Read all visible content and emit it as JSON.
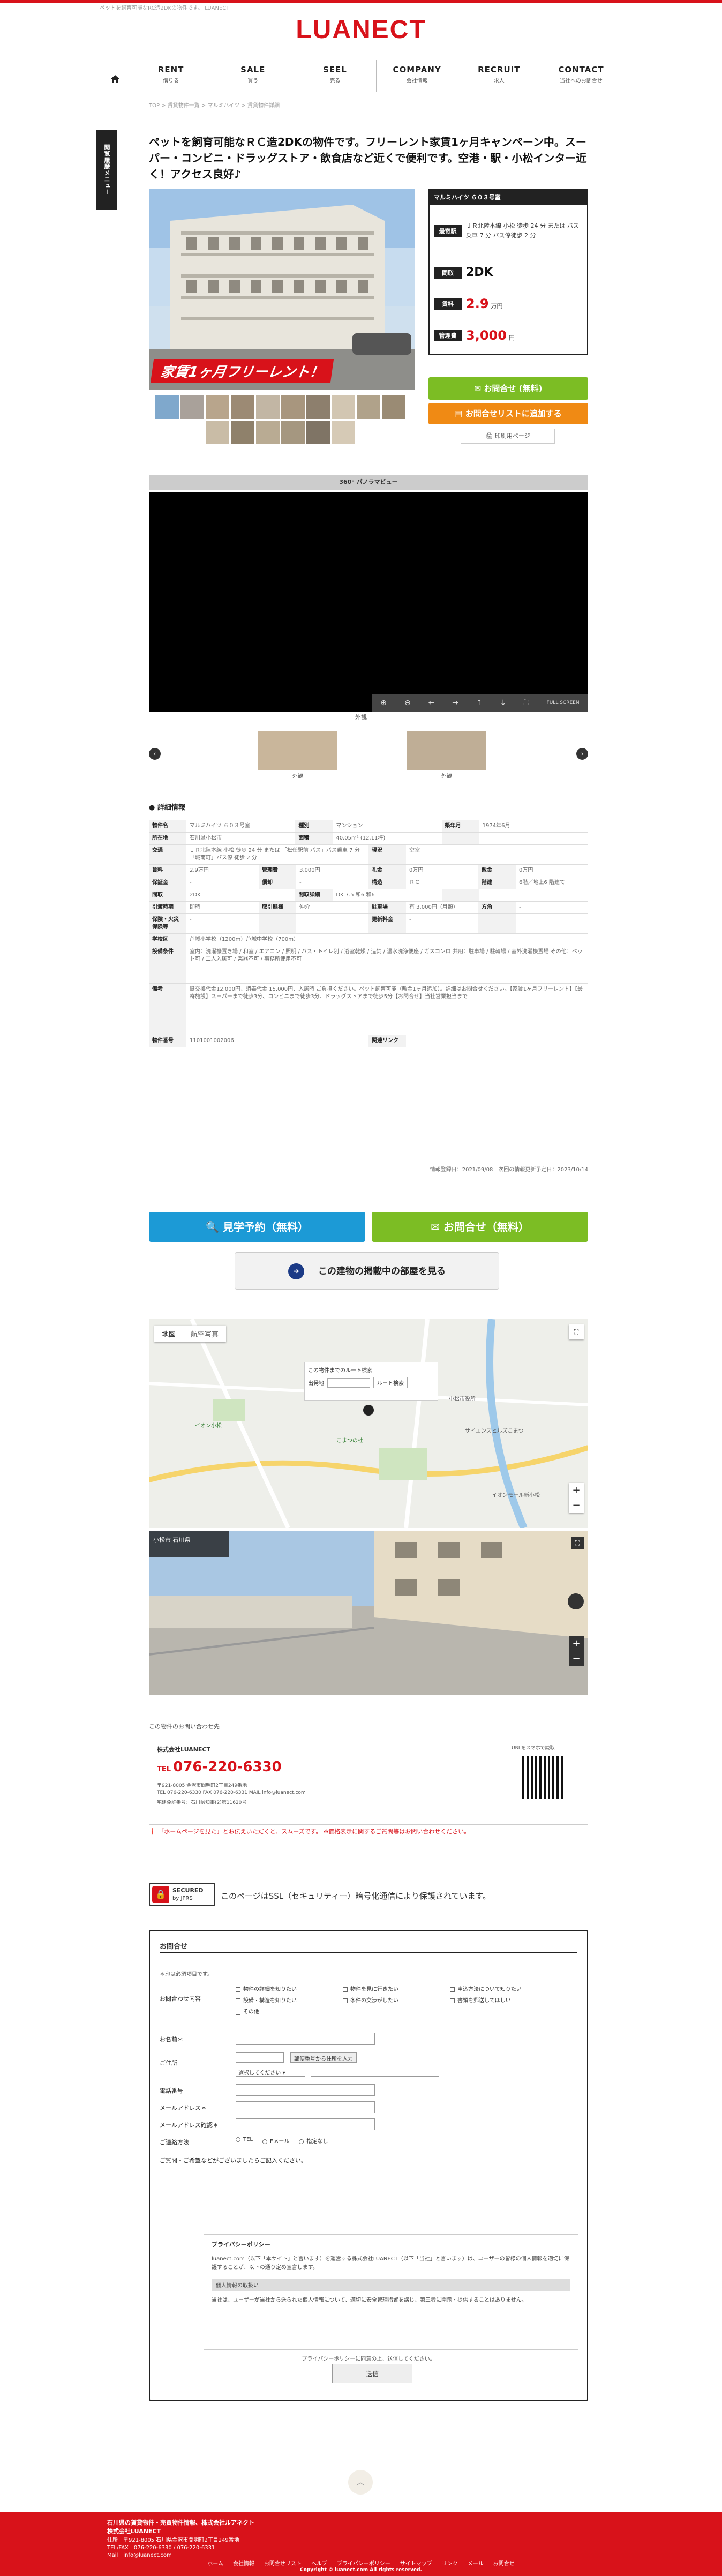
{
  "header": {
    "tagline": "ペットを飼育可能なRC造2DKの物件です。 LUANECT",
    "logo": "LUANECT"
  },
  "nav": [
    {
      "en": "RENT",
      "jp": "借りる"
    },
    {
      "en": "SALE",
      "jp": "買う"
    },
    {
      "en": "SEEL",
      "jp": "売る"
    },
    {
      "en": "COMPANY",
      "jp": "会社情報"
    },
    {
      "en": "RECRUIT",
      "jp": "求人"
    },
    {
      "en": "CONTACT",
      "jp": "当社へのお問合せ"
    }
  ],
  "breadcrumb": "TOP > 賃貸物件一覧 > マルミハイツ > 賃貸物件詳細",
  "sidetab": "閲覧履歴メニュー",
  "listing": {
    "title": "ペットを飼育可能なＲＣ造2DKの物件です。フリーレント家賃1ヶ月キャンペーン中。スーパー・コンビニ・ドラッグストア・飲食店など近くで便利です。空港・駅・小松インター近く！アクセス良好♪",
    "banner": "家賃1ヶ月フリーレント！",
    "info_header": "マルミハイツ ６０３号室",
    "station_label": "最寄駅",
    "station_value": "ＪＲ北陸本線 小松 徒歩 24 分 または バス乗車 7 分 バス停徒歩 2 分",
    "layout_label": "間取",
    "layout_value": "2DK",
    "rent_label": "賃料",
    "rent_value": "2.9",
    "rent_unit": "万円",
    "fee_label": "管理費",
    "fee_value": "3,000",
    "fee_unit": "円"
  },
  "buttons": {
    "inquiry": "お問合せ (無料)",
    "add_list": "お問合せリストに追加する",
    "print": "印刷用ページ",
    "visit": "見学予約（無料）",
    "inquiry2": "お問合せ（無料）",
    "other_rooms": "この建物の掲載中の部屋を見る"
  },
  "pano": {
    "header": "360° パノラマビュー",
    "sub": "外観",
    "thumb1": "外観",
    "thumb2": "外観",
    "zoom": "FULL SCREEN"
  },
  "detail": {
    "heading": "詳細情報",
    "rows": [
      [
        [
          "物件名",
          "マルミハイツ ６０３号室"
        ],
        [
          "種別",
          "マンション"
        ],
        [
          "築年月",
          "1974年6月"
        ]
      ],
      [
        [
          "所在地",
          "石川県小松市"
        ],
        [
          "面積",
          "40.05m² (12.11坪)"
        ],
        [
          "",
          ""
        ]
      ],
      [
        [
          "交通",
          "ＪＲ北陸本線 小松 徒歩 24 分 または 「松任駅前 バス」バス乗車 7 分 「城南町」バス停 徒歩 2 分"
        ],
        [
          "現況",
          "空室"
        ]
      ],
      [
        [
          "賃料",
          "2.9万円"
        ],
        [
          "管理費",
          "3,000円"
        ],
        [
          "礼金",
          "0万円"
        ],
        [
          "敷金",
          "0万円"
        ]
      ],
      [
        [
          "保証金",
          "-"
        ],
        [
          "償却",
          "-"
        ],
        [
          "構造",
          "ＲＣ"
        ],
        [
          "階建",
          "6階／地上6 階建て"
        ]
      ],
      [
        [
          "間取",
          "2DK"
        ],
        [
          "間取詳細",
          "DK 7.5 和6 和6"
        ],
        [
          "",
          ""
        ]
      ],
      [
        [
          "引渡時期",
          "即時"
        ],
        [
          "取引態様",
          "仲介"
        ],
        [
          "駐車場",
          "有 3,000円（月額）"
        ],
        [
          "方角",
          "-"
        ]
      ],
      [
        [
          "保険・火災保険等",
          "-"
        ],
        [
          "",
          ""
        ],
        [
          "更新料金",
          "-"
        ],
        [
          "",
          ""
        ]
      ],
      [
        [
          "学校区",
          "芦城小学校（1200m）芦城中学校（700m）"
        ]
      ],
      [
        [
          "設備条件",
          "室内：洗濯機置き場 / 和室 / エアコン / 照明 / バス・トイレ別 / 浴室乾燥 / 追焚 / 温水洗浄便座 / ガスコンロ 共用：駐車場 / 駐輪場 / 室外洗濯機置場 その他：ペット可 / 二人入居可 / 楽器不可 / 事務所使用不可"
        ]
      ],
      [
        [
          "備考",
          "鍵交換代金12,000円、消毒代金 15,000円、入居時 ご負担ください。ペット飼育可能（敷金1ヶ月追加）。詳細はお問合せください。【家賃1ヶ月フリーレント】【最寄施設】スーパーまで徒歩3分、コンビニまで徒歩3分、ドラッグストアまで徒歩5分【お問合せ】当社営業担当まで"
        ]
      ],
      [
        [
          "物件番号",
          "1101001002006"
        ],
        [
          "関連リンク",
          ""
        ]
      ]
    ],
    "dates": "情報登録日：2021/09/08　次回の情報更新予定日：2023/10/14"
  },
  "map": {
    "tab_map": "地図",
    "tab_sat": "航空写真",
    "route": "この物件までのルート検索",
    "from": "出発地",
    "route_btn": "ルート検索",
    "poi1": "イオン小松",
    "poi2": "こまつの杜",
    "poi3": "小松市役所",
    "poi4": "サイエンスヒルズこまつ",
    "poi5": "イオンモール新小松",
    "street_label": "小松市 石川県"
  },
  "contact": {
    "heading": "この物件のお問い合わせ先",
    "company": "株式会社LUANECT",
    "tel_prefix": "TEL",
    "tel": "076-220-6330",
    "addr": "〒921-8005 金沢市間明町2丁目249番地",
    "mail": "TEL 076-220-6330 FAX 076-220-6331 MAIL info@luanect.com",
    "license": "宅建免許番号：石川県知事(2)第11620号",
    "qr_label": "URLをスマホで読取"
  },
  "warning": "「ホームページを見た」とお伝えいただくと、スムーズです。 ※価格表示に関するご質問等はお問い合わせください。",
  "ssl": {
    "badge1": "SECURED",
    "badge2": "by JPRS",
    "text": "このページはSSL（セキュリティー）暗号化通信により保護されています。"
  },
  "form": {
    "title": "お問合せ",
    "note": "＊印は必須項目です。",
    "content_label": "お問合わせ内容",
    "options": [
      "物件の詳細を知りたい",
      "物件を見に行きたい",
      "申込方法について知りたい",
      "設備・構造を知りたい",
      "条件の交渉がしたい",
      "書類を郵送してほしい",
      "その他"
    ],
    "name_label": "お名前＊",
    "address_label": "ご住所",
    "zip_btn": "郵便番号から住所を入力",
    "pref_placeholder": "選択してください",
    "phone_label": "電話番号",
    "mail_label": "メールアドレス＊",
    "mail2_label": "メールアドレス確認＊",
    "method_label": "ご連絡方法",
    "methods": [
      "TEL",
      "Eメール",
      "指定なし"
    ],
    "message_label": "ご質問・ご希望などがございましたらご記入ください。",
    "privacy_title": "プライバシーポリシー",
    "privacy_text": "luanect.com（以下「本サイト」と言います）を運営する株式会社LUANECT（以下「当社」と言います）は、ユーザーの皆様の個人情報を適切に保護することが、以下の通り定め宣言します。",
    "privacy_sub": "個人情報の取扱い",
    "privacy_text2": "当社は、ユーザーが当社から送られた個人情報について、適切に安全管理措置を講じ、第三者に開示・提供することはありません。",
    "agree": "プライバシーポリシーに同意の上、送信してください。",
    "submit": "送信"
  },
  "footer": {
    "line1": "石川県の賃貸物件・売買物件情報、株式会社ルアネクト",
    "line2": "株式会社LUANECT",
    "addr": "住所　〒921-8005 石川県金沢市間明町2丁目249番地",
    "tel": "TEL/FAX　076-220-6330 / 076-220-6331",
    "mail": "Mail　info@luanect.com",
    "links": [
      "ホーム",
      "会社情報",
      "お問合せリスト",
      "ヘルプ",
      "プライバシーポリシー",
      "サイトマップ",
      "リンク",
      "メール",
      "お問合せ"
    ],
    "copy": "Copyright © luanect.com All rights reserved."
  }
}
